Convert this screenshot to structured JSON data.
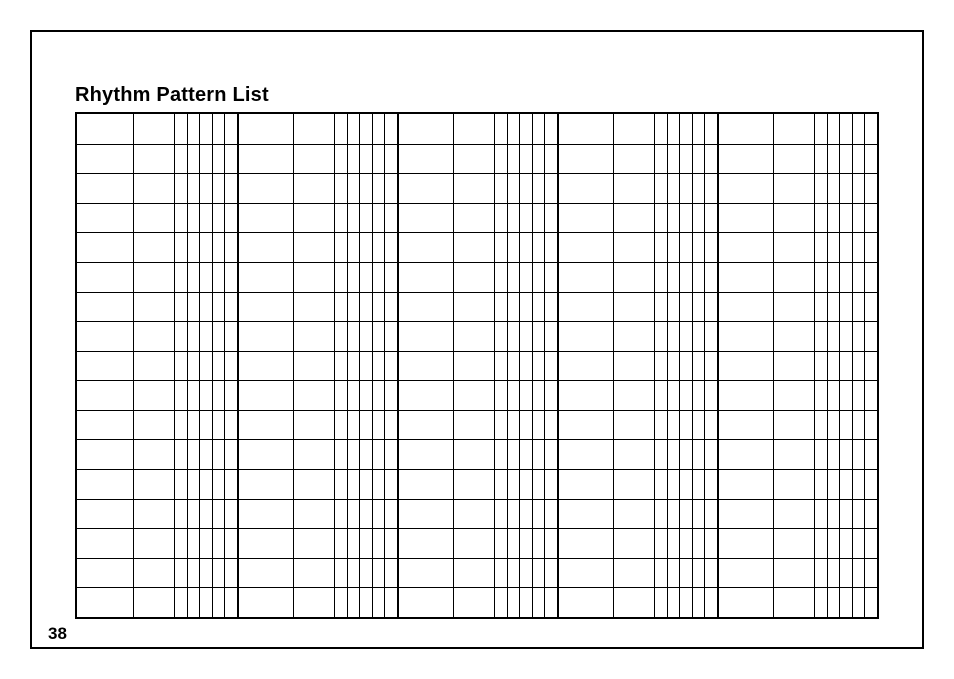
{
  "title": "Rhythm Pattern List",
  "page_number": "38",
  "grid": {
    "rows": 17,
    "groups": 5,
    "cols_per_group": [
      1,
      1,
      1,
      1,
      1,
      1
    ],
    "col_widths_pct": [
      6.0,
      4.6,
      1.4,
      1.4,
      1.4,
      1.4,
      1.4
    ],
    "thick_group_separators": true
  }
}
